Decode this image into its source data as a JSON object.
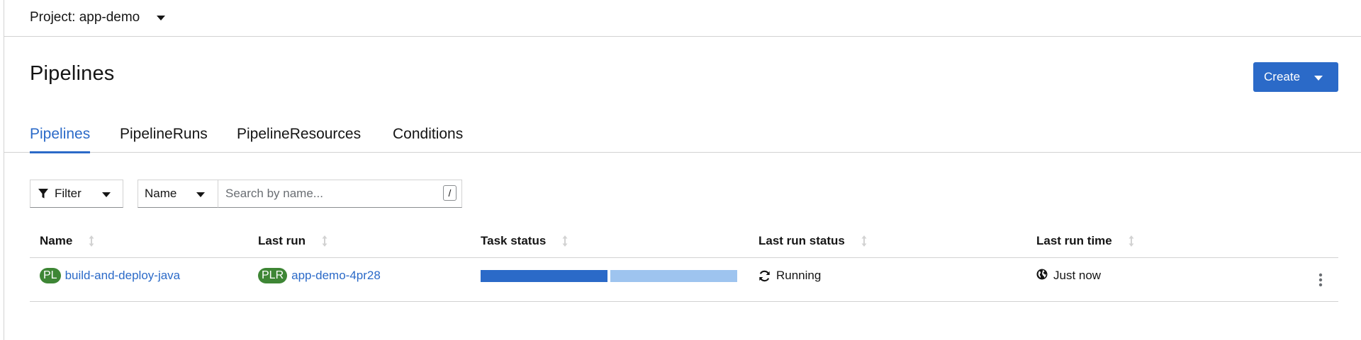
{
  "project": {
    "label": "Project: app-demo"
  },
  "page": {
    "title": "Pipelines",
    "create_label": "Create"
  },
  "tabs": [
    {
      "label": "Pipelines",
      "active": true
    },
    {
      "label": "PipelineRuns",
      "active": false
    },
    {
      "label": "PipelineResources",
      "active": false
    },
    {
      "label": "Conditions",
      "active": false
    }
  ],
  "toolbar": {
    "filter_label": "Filter",
    "name_select_value": "Name",
    "search_placeholder": "Search by name...",
    "search_value": "",
    "search_shortcut": "/"
  },
  "table": {
    "columns": [
      "Name",
      "Last run",
      "Task status",
      "Last run status",
      "Last run time"
    ],
    "rows": [
      {
        "name_badge": "PL",
        "name": "build-and-deploy-java",
        "last_run_badge": "PLR",
        "last_run": "app-demo-4pr28",
        "task_status": {
          "total_tasks": 2,
          "completed": 1,
          "in_progress": 1
        },
        "last_run_status": "Running",
        "last_run_time": "Just now"
      }
    ]
  },
  "colors": {
    "accent": "#2b6ac8",
    "task_completed": "#2b6ac8",
    "task_running": "#9ec4ef",
    "badge_green": "#3e8635",
    "border": "#d2d2d2"
  },
  "icons": {
    "project_caret": "caret-down-icon",
    "create_caret": "caret-down-icon",
    "filter": "filter-icon",
    "sort": "sort-icon",
    "running": "sync-icon",
    "time": "globe-icon",
    "row_actions": "kebab-icon"
  }
}
